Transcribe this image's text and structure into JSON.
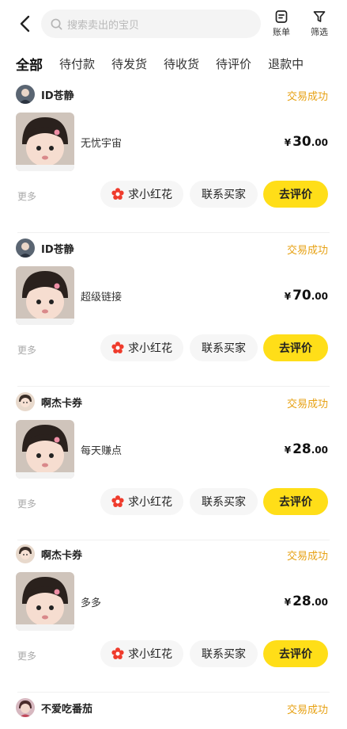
{
  "header": {
    "search_placeholder": "搜索卖出的宝贝",
    "bill_label": "账单",
    "filter_label": "筛选"
  },
  "tabs": [
    {
      "label": "全部",
      "active": true
    },
    {
      "label": "待付款"
    },
    {
      "label": "待发货"
    },
    {
      "label": "待收货"
    },
    {
      "label": "待评价"
    },
    {
      "label": "退款中"
    }
  ],
  "orders": [
    {
      "shop": "ID苍静",
      "status": "交易成功",
      "title": "无忧宇宙",
      "currency": "¥",
      "price_int": "30",
      "price_dec": ".00",
      "more": "更多",
      "flower_btn": "求小红花",
      "contact_btn": "联系买家",
      "review_btn": "去评价"
    },
    {
      "shop": "ID苍静",
      "status": "交易成功",
      "title": "超级链接",
      "currency": "¥",
      "price_int": "70",
      "price_dec": ".00",
      "more": "更多",
      "flower_btn": "求小红花",
      "contact_btn": "联系买家",
      "review_btn": "去评价"
    },
    {
      "shop": "啊杰卡券",
      "status": "交易成功",
      "title": "每天赚点",
      "currency": "¥",
      "price_int": "28",
      "price_dec": ".00",
      "more": "更多",
      "flower_btn": "求小红花",
      "contact_btn": "联系买家",
      "review_btn": "去评价"
    },
    {
      "shop": "啊杰卡券",
      "status": "交易成功",
      "title": "多多",
      "currency": "¥",
      "price_int": "28",
      "price_dec": ".00",
      "more": "更多",
      "flower_btn": "求小红花",
      "contact_btn": "联系买家",
      "review_btn": "去评价"
    },
    {
      "shop": "不爱吃番茄",
      "status": "交易成功"
    }
  ],
  "colors": {
    "accent_yellow": "#ffde18",
    "status_orange": "#e7a215",
    "flower_red": "#ef3b2c"
  },
  "icons": [
    "back-arrow-icon",
    "search-icon",
    "bill-icon",
    "filter-icon",
    "flower-icon"
  ]
}
